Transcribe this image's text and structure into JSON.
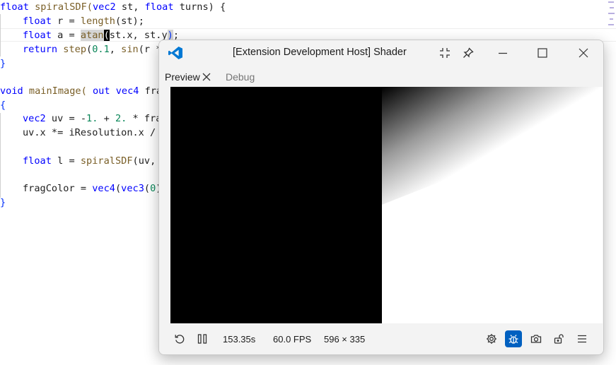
{
  "editor": {
    "line1": {
      "t1": "float",
      "t2": " spiralSDF(",
      "t3": "vec2",
      "t4": " st, ",
      "t5": "float",
      "t6": " turns) {"
    },
    "line2": {
      "t1": "float",
      "t2": " r = ",
      "t3": "length",
      "t4": "(st);"
    },
    "line3": {
      "t1": "float",
      "t2": " a = ",
      "t3": "atan",
      "t4": "(",
      "t5": "st.x, st.y",
      "t6": ")",
      "t7": ";"
    },
    "line4": {
      "t1": "return",
      "t2": " ",
      "t3": "step",
      "t4": "(",
      "t5": "0.1",
      "t6": ", ",
      "t7": "sin",
      "t8": "(r *"
    },
    "line5": {
      "t1": "}"
    },
    "line7": {
      "t1": "void",
      "t2": " mainImage( ",
      "t3": "out",
      "t4": " ",
      "t5": "vec4",
      "t6": " fra"
    },
    "line8": {
      "t1": "{"
    },
    "line9": {
      "t1": "vec2",
      "t2": " uv = -",
      "t3": "1.",
      "t4": " + ",
      "t5": "2.",
      "t6": " * fra"
    },
    "line10": {
      "t1": "uv.x *= iResolution.x /"
    },
    "line12": {
      "t1": "float",
      "t2": " l = ",
      "t3": "spiralSDF",
      "t4": "(uv,"
    },
    "line14": {
      "t1": "fragColor = ",
      "t2": "vec4",
      "t3": "(",
      "t4": "vec3",
      "t5": "(",
      "t6": "0",
      "t7": ")"
    },
    "line15": {
      "t1": "}"
    }
  },
  "host_window": {
    "title": "[Extension Development Host] Shader S...",
    "tabs": {
      "preview": "Preview",
      "debug": "Debug"
    },
    "icons": {
      "logo": "vscode-logo-icon",
      "collapse": "collapse-icon",
      "pin": "pin-icon",
      "minimize": "minimize-icon",
      "maximize": "maximize-icon",
      "close": "close-icon"
    },
    "status": {
      "time": "153.35s",
      "fps": "60.0 FPS",
      "resolution": "596 × 335"
    },
    "colors": {
      "accent": "#0060c0",
      "logo": "#0078d4"
    }
  }
}
